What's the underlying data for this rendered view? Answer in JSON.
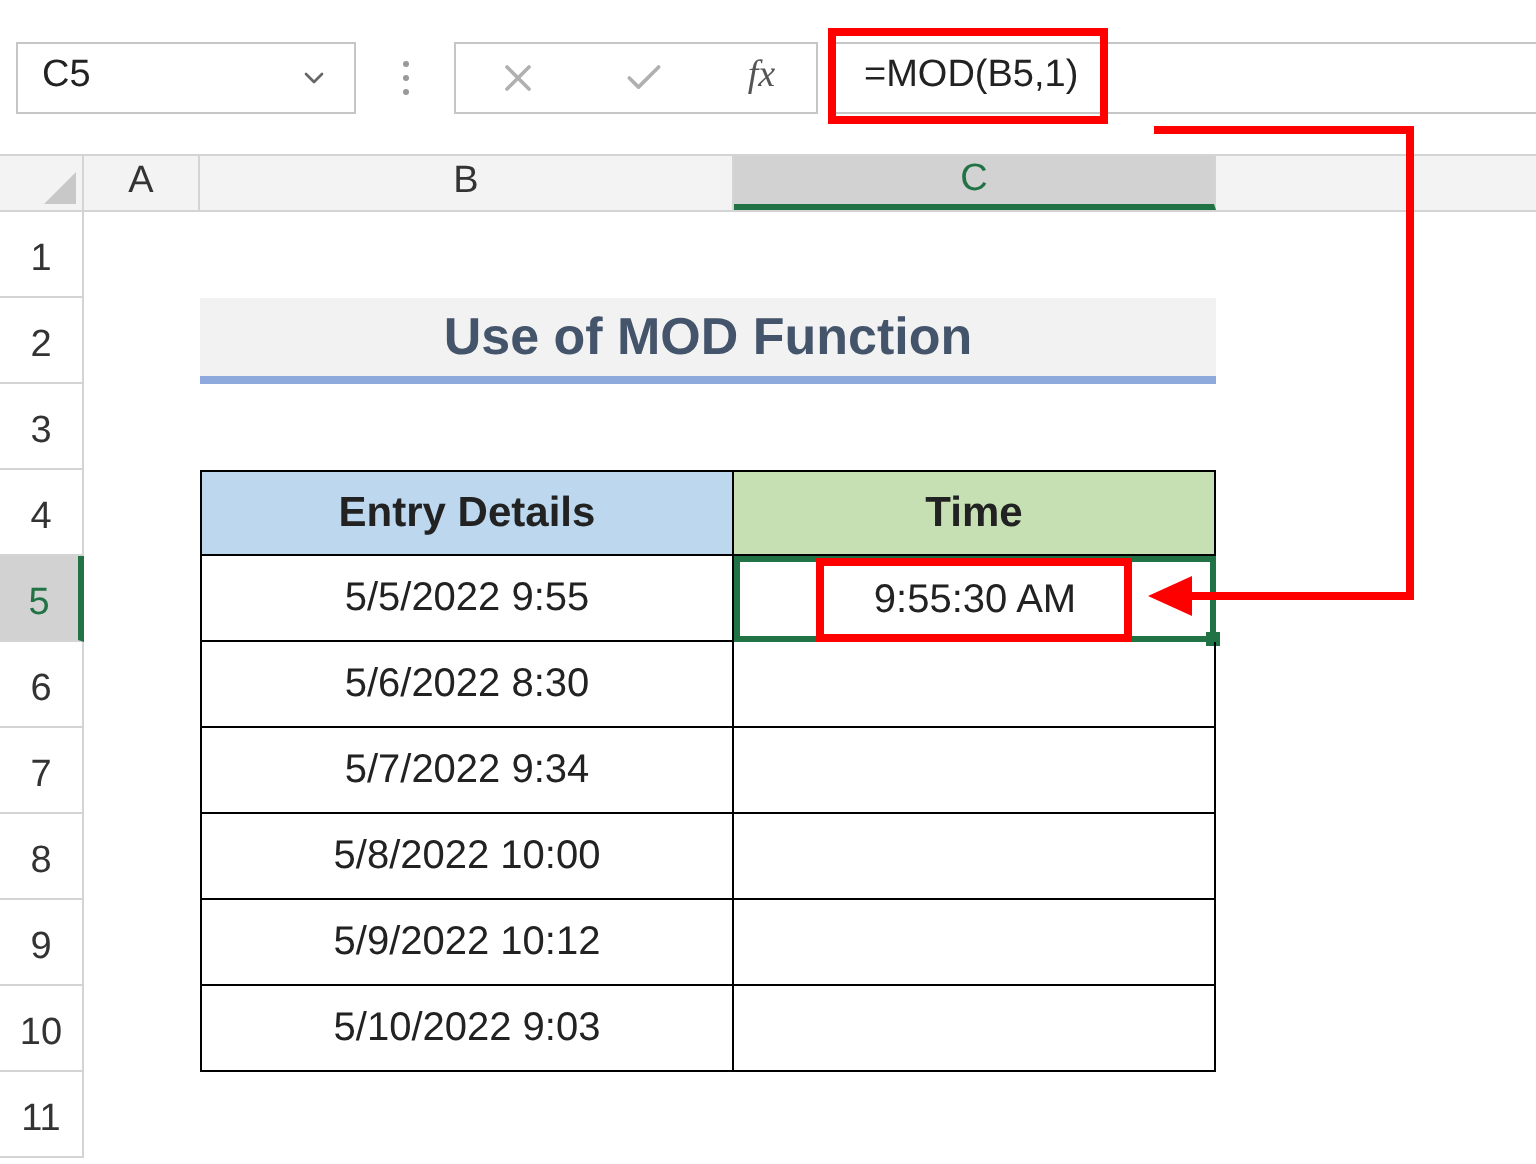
{
  "name_box": {
    "value": "C5"
  },
  "formula_bar": {
    "function_label": "fx",
    "formula": "=MOD(B5,1)",
    "highlighted": true
  },
  "columns": [
    {
      "label": "A",
      "selected": false
    },
    {
      "label": "B",
      "selected": false
    },
    {
      "label": "C",
      "selected": true
    }
  ],
  "rows": [
    {
      "label": "1",
      "selected": false
    },
    {
      "label": "2",
      "selected": false
    },
    {
      "label": "3",
      "selected": false
    },
    {
      "label": "4",
      "selected": false
    },
    {
      "label": "5",
      "selected": true
    },
    {
      "label": "6",
      "selected": false
    },
    {
      "label": "7",
      "selected": false
    },
    {
      "label": "8",
      "selected": false
    },
    {
      "label": "9",
      "selected": false
    },
    {
      "label": "10",
      "selected": false
    },
    {
      "label": "11",
      "selected": false
    }
  ],
  "title": "Use of MOD Function",
  "table": {
    "columns": [
      "Entry Details",
      "Time"
    ],
    "result_highlighted": true,
    "rows": [
      {
        "entry": "5/5/2022 9:55",
        "time": "9:55:30 AM",
        "selected": true
      },
      {
        "entry": "5/6/2022 8:30",
        "selected": false
      },
      {
        "entry": "5/7/2022 9:34",
        "selected": false
      },
      {
        "entry": "5/8/2022 10:00",
        "selected": false
      },
      {
        "entry": "5/9/2022 10:12",
        "selected": false
      },
      {
        "entry": "5/10/2022 9:03",
        "selected": false
      }
    ]
  }
}
